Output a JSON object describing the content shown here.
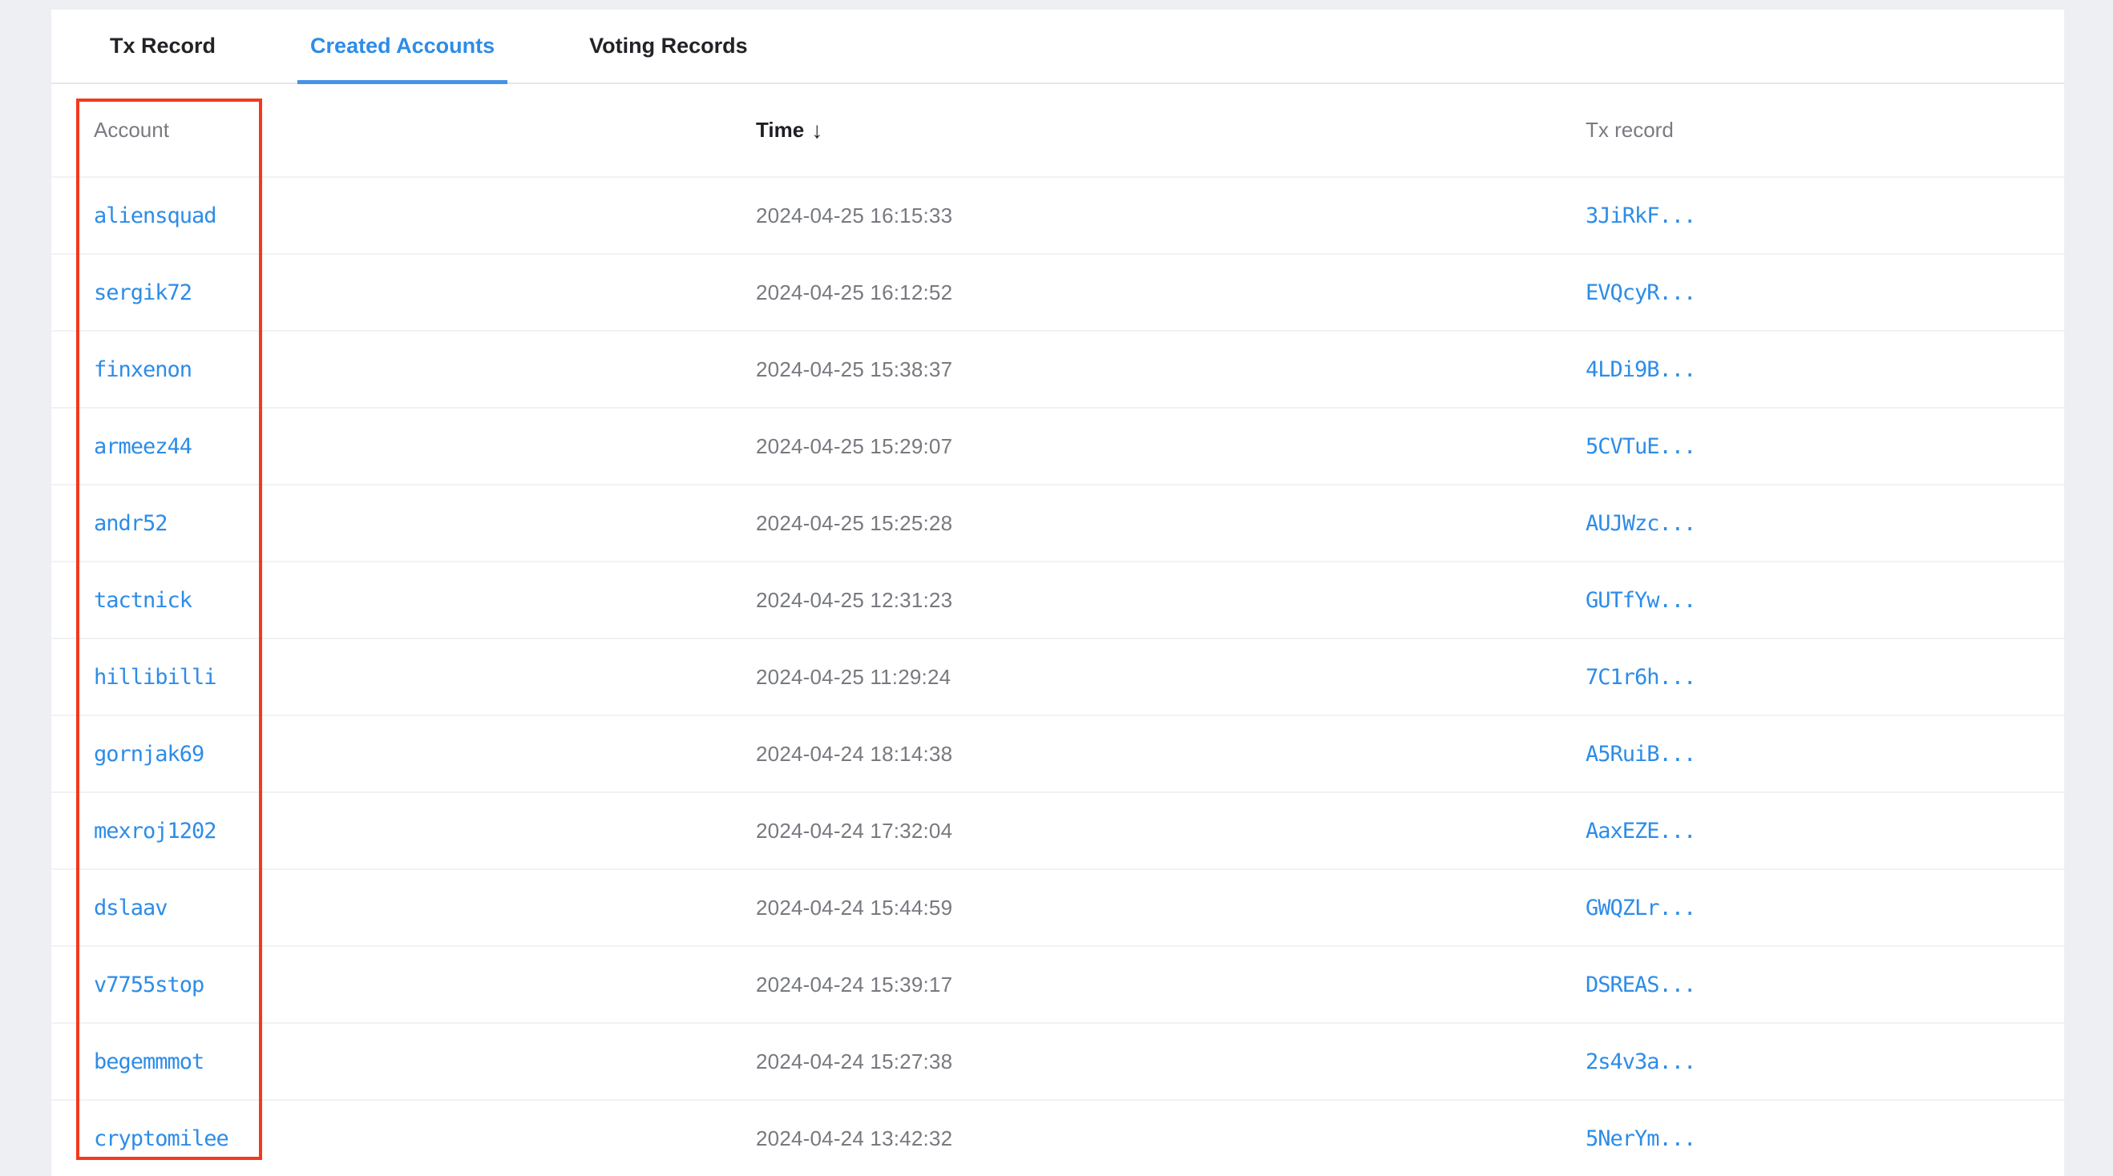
{
  "tabs": [
    {
      "label": "Tx Record",
      "active": false
    },
    {
      "label": "Created Accounts",
      "active": true
    },
    {
      "label": "Voting Records",
      "active": false
    }
  ],
  "table": {
    "columns": {
      "account": "Account",
      "time": "Time",
      "tx": "Tx record"
    },
    "sort_indicator": "↓",
    "rows": [
      {
        "account": "aliensquad",
        "time": "2024-04-25 16:15:33",
        "tx": "3JiRkF..."
      },
      {
        "account": "sergik72",
        "time": "2024-04-25 16:12:52",
        "tx": "EVQcyR..."
      },
      {
        "account": "finxenon",
        "time": "2024-04-25 15:38:37",
        "tx": "4LDi9B..."
      },
      {
        "account": "armeez44",
        "time": "2024-04-25 15:29:07",
        "tx": "5CVTuE..."
      },
      {
        "account": "andr52",
        "time": "2024-04-25 15:25:28",
        "tx": "AUJWzc..."
      },
      {
        "account": "tactnick",
        "time": "2024-04-25 12:31:23",
        "tx": "GUTfYw..."
      },
      {
        "account": "hillibilli",
        "time": "2024-04-25 11:29:24",
        "tx": "7C1r6h..."
      },
      {
        "account": "gornjak69",
        "time": "2024-04-24 18:14:38",
        "tx": "A5RuiB..."
      },
      {
        "account": "mexroj1202",
        "time": "2024-04-24 17:32:04",
        "tx": "AaxEZE..."
      },
      {
        "account": "dslaav",
        "time": "2024-04-24 15:44:59",
        "tx": "GWQZLr..."
      },
      {
        "account": "v7755stop",
        "time": "2024-04-24 15:39:17",
        "tx": "DSREAS..."
      },
      {
        "account": "begemmmot",
        "time": "2024-04-24 15:27:38",
        "tx": "2s4v3a..."
      },
      {
        "account": "cryptomilee",
        "time": "2024-04-24 13:42:32",
        "tx": "5NerYm..."
      }
    ]
  },
  "colors": {
    "link_blue": "#2d8ce8",
    "active_tab_underline": "#4692e6",
    "annotation_red": "#f23a1d",
    "page_background": "#edeff2",
    "row_separator": "#f0f2f4"
  }
}
